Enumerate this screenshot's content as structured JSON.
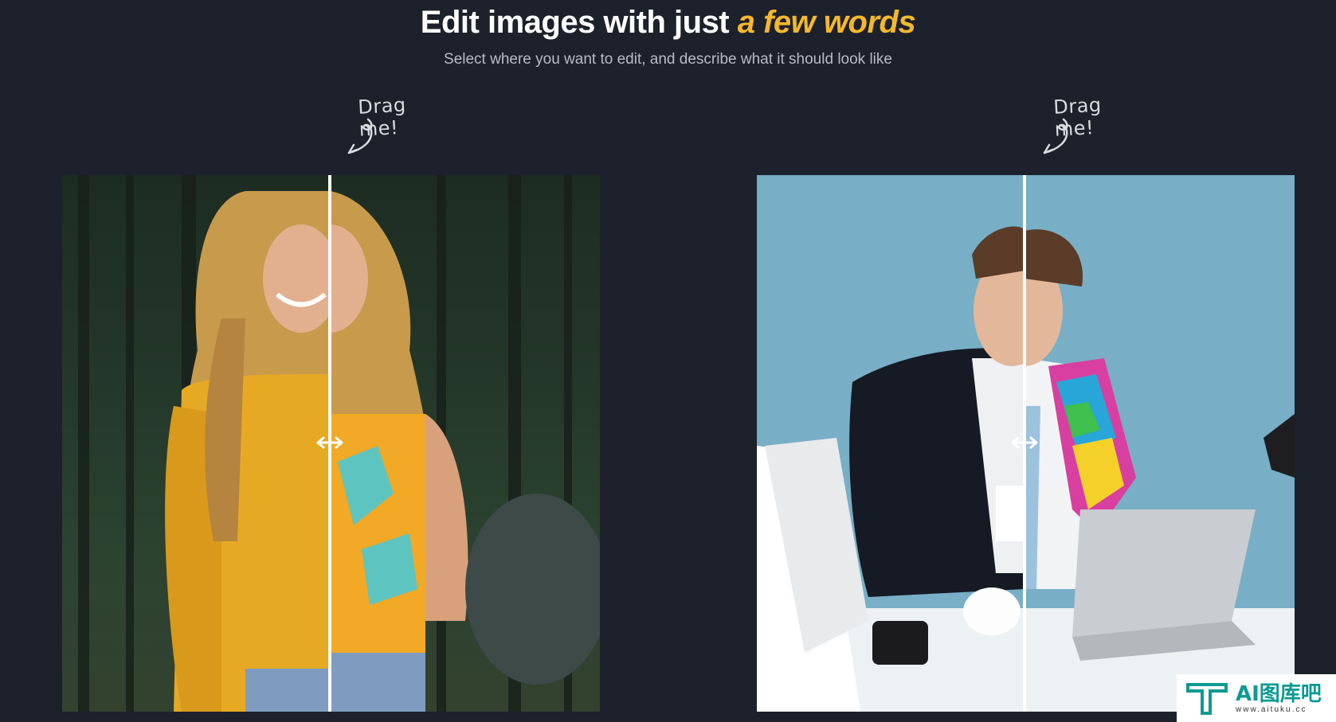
{
  "hero": {
    "title_main": "Edit images with just ",
    "title_accent": "a few words",
    "subtitle": "Select where you want to edit, and describe what it should look like"
  },
  "drag_hints": [
    {
      "label": "Drag me!"
    },
    {
      "label": "Drag me!"
    }
  ],
  "comparisons": [
    {
      "subject": "woman-yellow-sweater",
      "edit": "patterned-top"
    },
    {
      "subject": "man-blue-background",
      "edit": "colorful-jacket-sleeve"
    }
  ],
  "icons": {
    "arrow": "curly-arrow-icon",
    "handle": "horizontal-resize-icon"
  },
  "watermark": {
    "name": "AI图库吧",
    "url": "www.aituku.cc"
  },
  "colors": {
    "background": "#1c212b",
    "accent": "#f5b82a",
    "subtitle": "#b7bcc6",
    "watermark_teal": "#0d9a93"
  }
}
